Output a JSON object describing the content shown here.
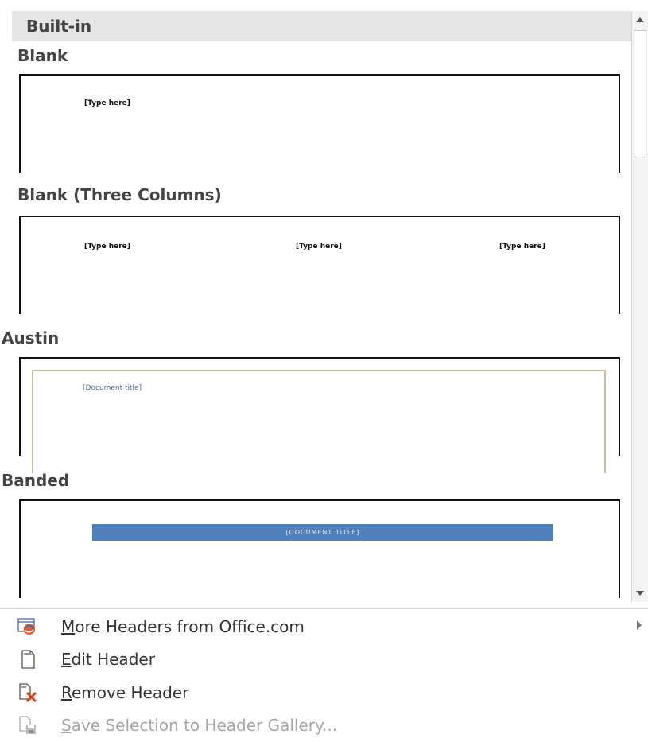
{
  "gallery": {
    "header": "Built-in",
    "sections": [
      {
        "title": "Blank",
        "placeholders": [
          "[Type here]"
        ]
      },
      {
        "title": "Blank (Three Columns)",
        "placeholders": [
          "[Type here]",
          "[Type here]",
          "[Type here]"
        ]
      },
      {
        "title": "Austin",
        "placeholders": [
          "[Document title]"
        ]
      },
      {
        "title": "Banded",
        "placeholders": [
          "[DOCUMENT TITLE]"
        ]
      }
    ]
  },
  "menu": {
    "more": {
      "key": "M",
      "rest": "ore Headers from Office.com"
    },
    "edit": {
      "key": "E",
      "rest": "dit Header"
    },
    "remove": {
      "key": "R",
      "rest": "emove Header"
    },
    "save": {
      "key": "S",
      "rest": "ave Selection to Header Gallery..."
    }
  },
  "colors": {
    "accent_band": "#4f81bd",
    "austin_frame": "#c6bf9f",
    "disabled_text": "#a6a6a6"
  }
}
